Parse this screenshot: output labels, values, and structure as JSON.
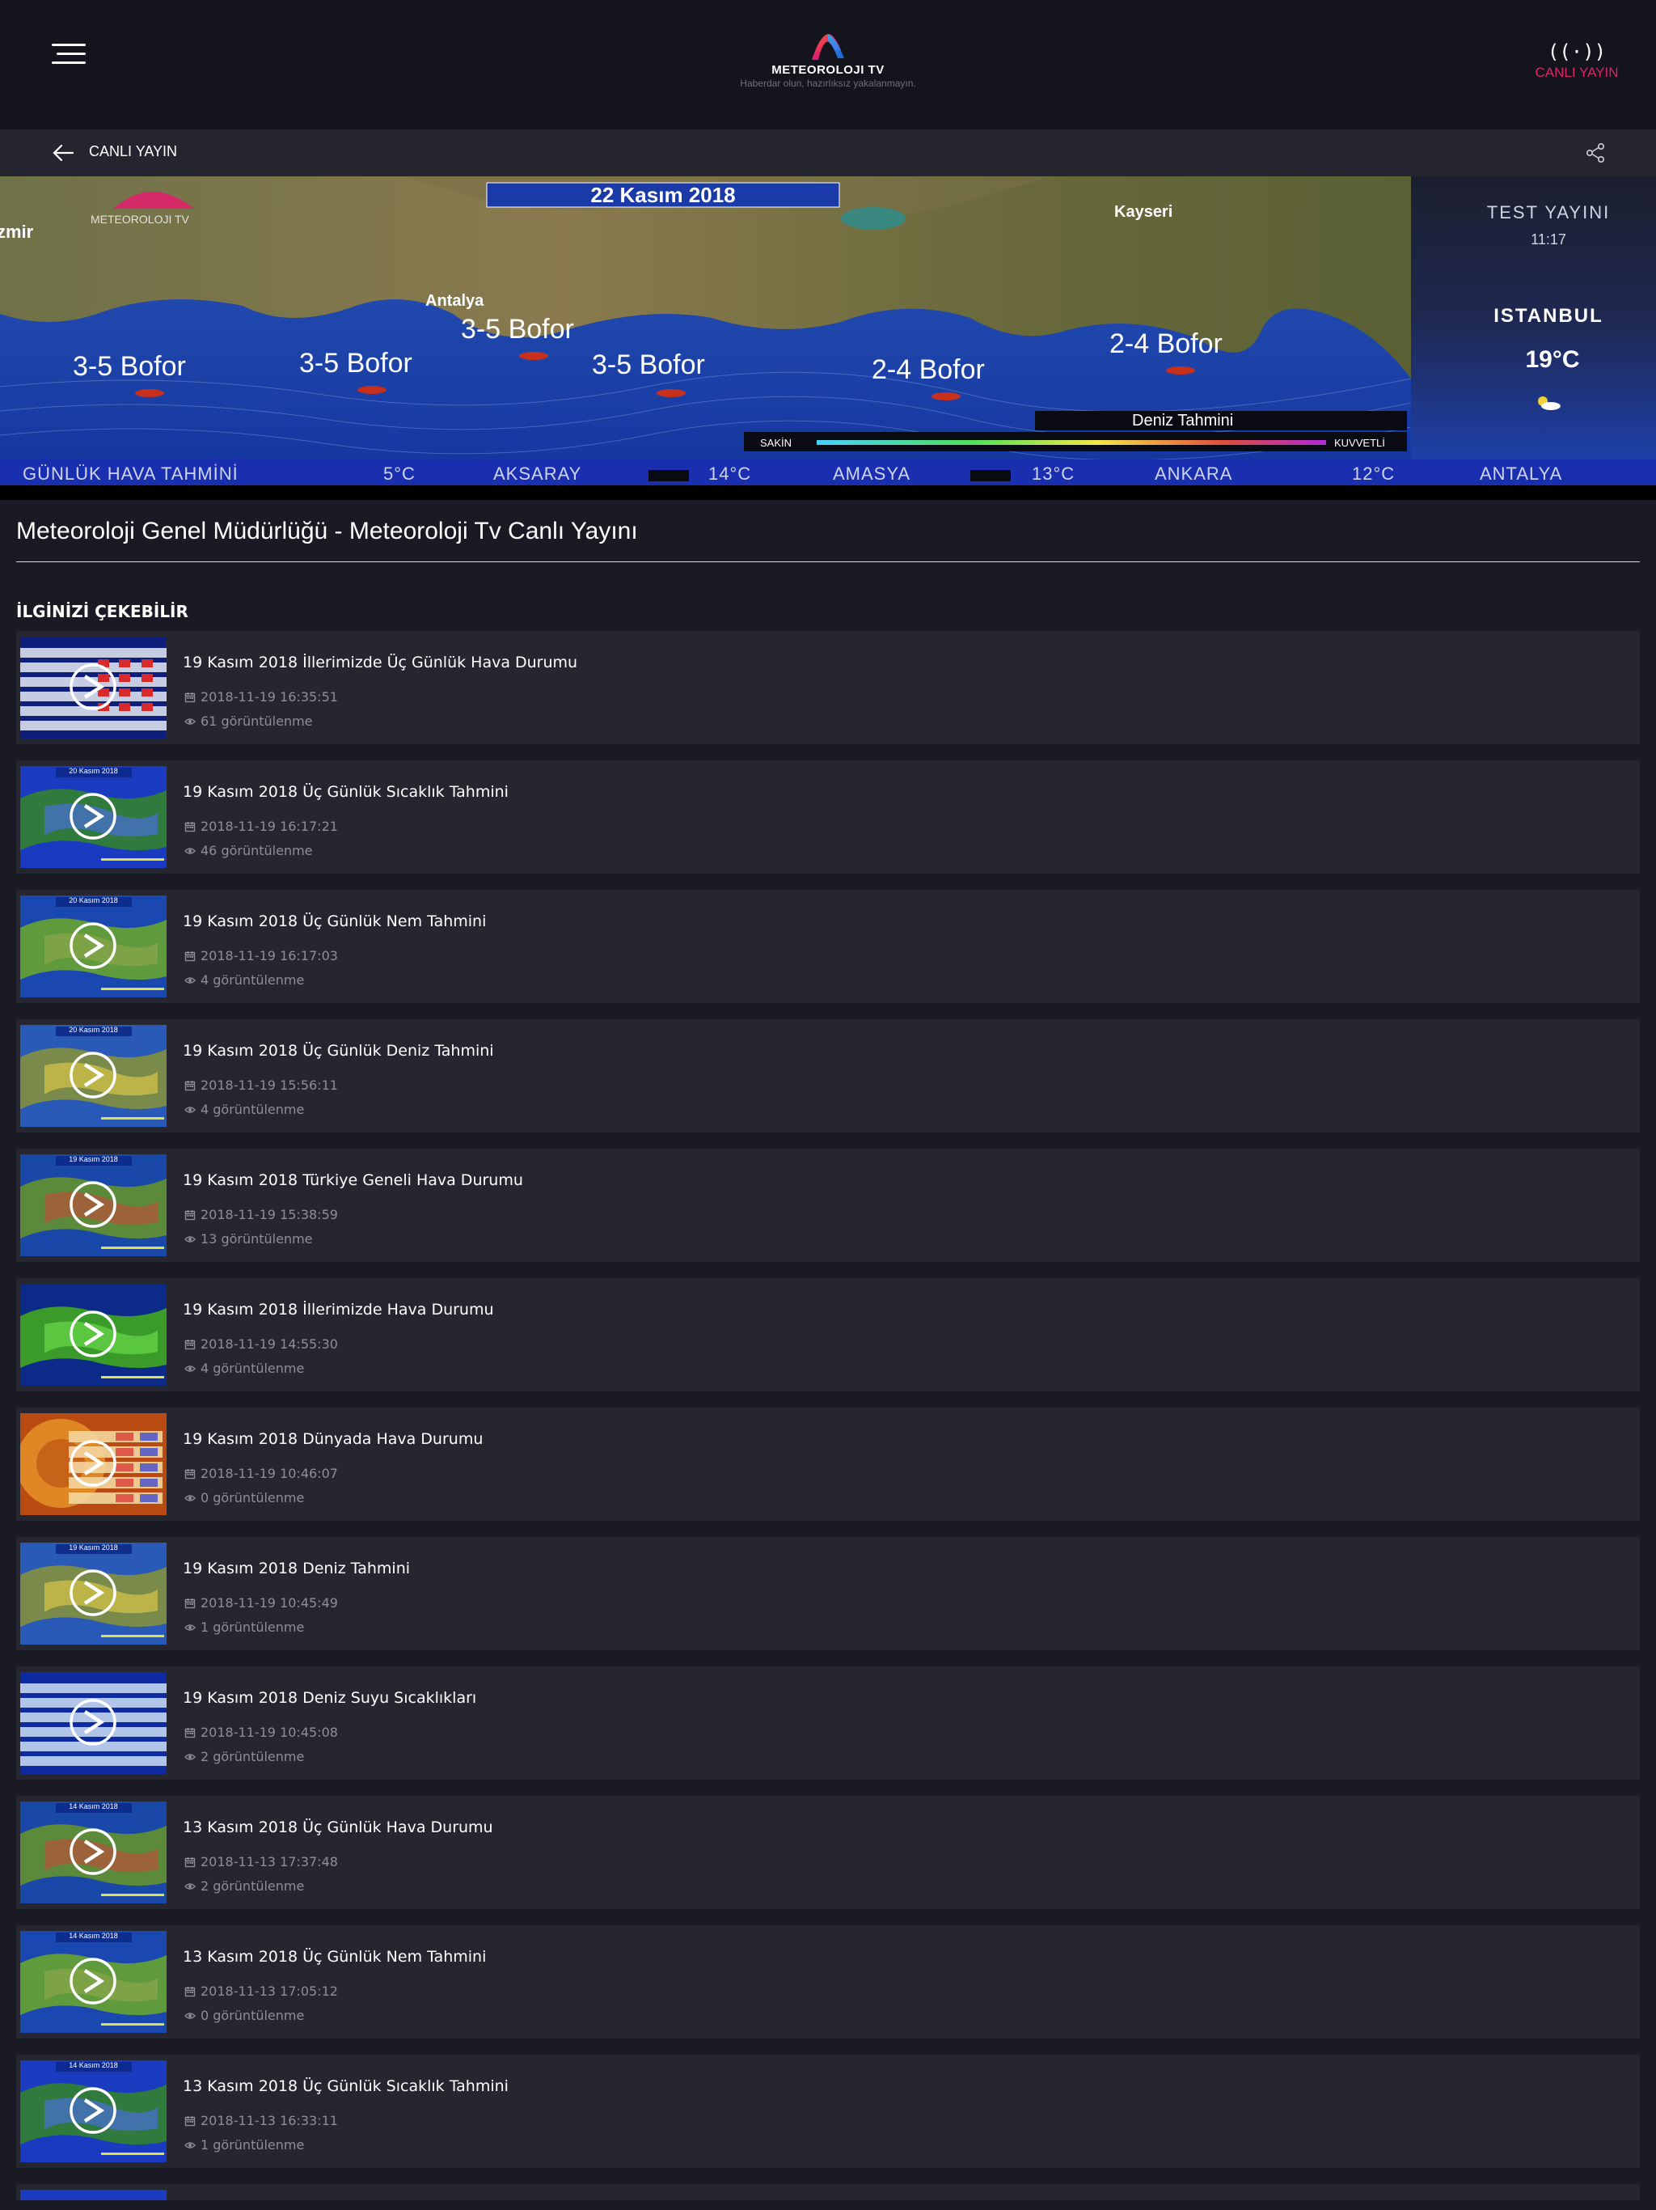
{
  "header": {
    "logo_text": "METEOROLOJI TV",
    "tagline": "Haberdar olun, hazırlıksız yakalanmayın.",
    "live_label": "CANLI YAYIN",
    "live_icon": "((·))"
  },
  "subbar": {
    "title": "CANLI YAYIN"
  },
  "video": {
    "date_banner": "22 Kasım 2018",
    "channel": "TEST YAYINI",
    "clock": "11:17",
    "city": "ISTANBUL",
    "temp": "19°C",
    "map_labels": [
      "zmir",
      "Antalya",
      "Kayseri",
      "3-5 Bofor",
      "3-5 Bofor",
      "3-5 Bofor",
      "3-5 Bofor",
      "2-4 Bofor",
      "2-4 Bofor",
      "Deniz Tahmini",
      "SAKİN",
      "KUVVETLİ"
    ],
    "ticker": [
      "GÜNLÜK HAVA TAHMİNİ",
      "5°C",
      "AKSARAY",
      "14°C",
      "AMASYA",
      "13°C",
      "ANKARA",
      "12°C",
      "ANTALYA"
    ]
  },
  "page_title": "Meteoroloji Genel Müdürlüğü - Meteoroloji Tv Canlı Yayını",
  "section_title": "İLGİNİZİ ÇEKEBİLİR",
  "items": [
    {
      "title": "19 Kasım 2018 İllerimizde Üç Günlük Hava Durumu",
      "date": "2018-11-19 16:35:51",
      "views": "61 görüntülenme",
      "thumb": "table-blue"
    },
    {
      "title": "19 Kasım 2018 Üç Günlük Sıcaklık Tahmini",
      "date": "2018-11-19 16:17:21",
      "views": "46 görüntülenme",
      "thumb": "map-blue",
      "banner": "20 Kasım 2018"
    },
    {
      "title": "19 Kasım 2018 Üç Günlük Nem Tahmini",
      "date": "2018-11-19 16:17:03",
      "views": "4 görüntülenme",
      "thumb": "map-green",
      "banner": "20 Kasım 2018"
    },
    {
      "title": "19 Kasım 2018 Üç Günlük Deniz Tahmini",
      "date": "2018-11-19 15:56:11",
      "views": "4 görüntülenme",
      "thumb": "map-sea",
      "banner": "20 Kasım 2018"
    },
    {
      "title": "19 Kasım 2018 Türkiye Geneli Hava Durumu",
      "date": "2018-11-19 15:38:59",
      "views": "13 görüntülenme",
      "thumb": "map-presenter",
      "banner": "19 Kasım 2018"
    },
    {
      "title": "19 Kasım 2018 İllerimizde Hava Durumu",
      "date": "2018-11-19 14:55:30",
      "views": "4 görüntülenme",
      "thumb": "map-radar"
    },
    {
      "title": "19 Kasım 2018 Dünyada Hava Durumu",
      "date": "2018-11-19 10:46:07",
      "views": "0 görüntülenme",
      "thumb": "world"
    },
    {
      "title": "19 Kasım 2018 Deniz Tahmini",
      "date": "2018-11-19 10:45:49",
      "views": "1 görüntülenme",
      "thumb": "map-sea",
      "banner": "19 Kasım 2018"
    },
    {
      "title": "19 Kasım 2018 Deniz Suyu Sıcaklıkları",
      "date": "2018-11-19 10:45:08",
      "views": "2 görüntülenme",
      "thumb": "table-sea"
    },
    {
      "title": "13 Kasım 2018 Üç Günlük Hava Durumu",
      "date": "2018-11-13 17:37:48",
      "views": "2 görüntülenme",
      "thumb": "map-presenter",
      "banner": "14 Kasım 2018"
    },
    {
      "title": "13 Kasım 2018 Üç Günlük Nem Tahmini",
      "date": "2018-11-13 17:05:12",
      "views": "0 görüntülenme",
      "thumb": "map-green",
      "banner": "14 Kasım 2018"
    },
    {
      "title": "13 Kasım 2018 Üç Günlük Sıcaklık Tahmini",
      "date": "2018-11-13 16:33:11",
      "views": "1 görüntülenme",
      "thumb": "map-blue",
      "banner": "14 Kasım 2018"
    },
    {
      "title": "",
      "date": "",
      "views": "",
      "thumb": "map-blue",
      "partial": true
    }
  ],
  "colors": {
    "background": "#1a1a24",
    "header": "#14141c",
    "card": "#262631",
    "accent": "#e0226b",
    "meta_text": "#8e8e9c"
  }
}
